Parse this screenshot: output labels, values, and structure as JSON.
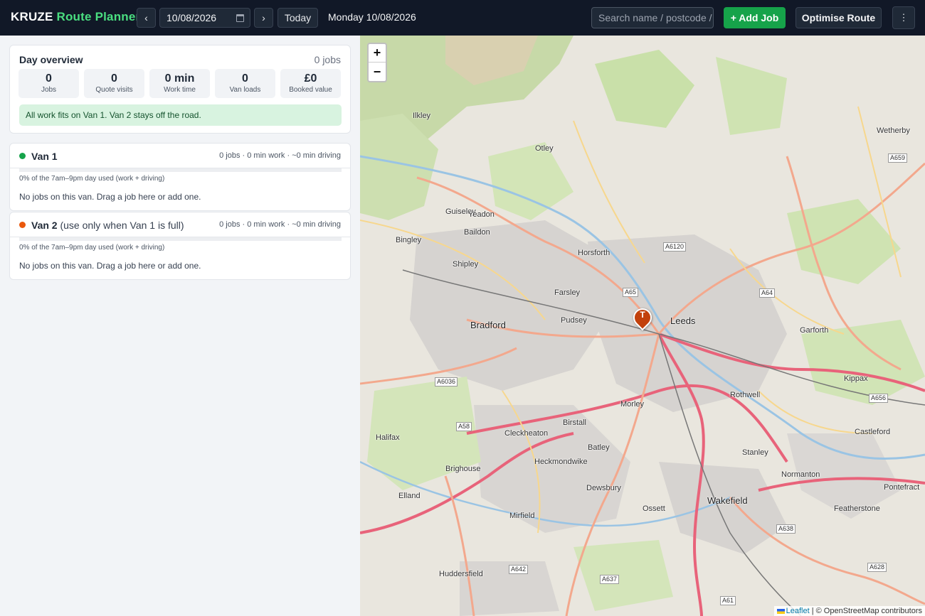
{
  "header": {
    "brand_part1": "KRUZE",
    "brand_part2": "Route Planner",
    "prev_label": "‹",
    "next_label": "›",
    "date_value": "10/08/2026",
    "today_label": "Today",
    "day_label": "Monday 10/08/2026",
    "search_placeholder": "Search name / postcode / ...",
    "add_job_label": "+ Add Job",
    "optimise_label": "Optimise Route",
    "more_label": "⋮"
  },
  "overview": {
    "title": "Day overview",
    "count": "0 jobs",
    "stats": [
      {
        "value": "0",
        "label": "Jobs"
      },
      {
        "value": "0",
        "label": "Quote visits"
      },
      {
        "value": "0 min",
        "label": "Work time"
      },
      {
        "value": "0",
        "label": "Van loads"
      },
      {
        "value": "£0",
        "label": "Booked value"
      }
    ],
    "note": "All work fits on Van 1. Van 2 stays off the road."
  },
  "vans": [
    {
      "name": "Van 1",
      "subtitle": "",
      "color": "#16a34a",
      "stats": "0 jobs · 0 min work · ~0 min driving",
      "usage_fraction": 0,
      "usage_text": "0% of the 7am–9pm day used (work + driving)",
      "empty_text": "No jobs on this van. Drag a job here or add one."
    },
    {
      "name": "Van 2",
      "subtitle": "(use only when Van 1 is full)",
      "color": "#ea580c",
      "stats": "0 jobs · 0 min work · ~0 min driving",
      "usage_fraction": 0,
      "usage_text": "0% of the 7am–9pm day used (work + driving)",
      "empty_text": "No jobs on this van. Drag a job here or add one."
    }
  ],
  "map": {
    "zoom_in": "+",
    "zoom_out": "−",
    "marker_letter": "T",
    "attribution_link": "Leaflet",
    "attribution_text": "| © OpenStreetMap contributors",
    "towns": [
      "Ilkley",
      "Otley",
      "Wetherby",
      "Guiseley",
      "Yeadon",
      "Baildon",
      "Bingley",
      "Horsforth",
      "Shipley",
      "Farsley",
      "Bradford",
      "Pudsey",
      "Leeds",
      "Garforth",
      "Kippax",
      "Rothwell",
      "Morley",
      "Birstall",
      "Cleckheaton",
      "Halifax",
      "Batley",
      "Castleford",
      "Stanley",
      "Heckmondwike",
      "Brighouse",
      "Dewsbury",
      "Normanton",
      "Pontefract",
      "Elland",
      "Ossett",
      "Wakefield",
      "Featherstone",
      "Mirfield",
      "Huddersfield"
    ],
    "roads": [
      "A659",
      "A6120",
      "A65",
      "A64",
      "A6036",
      "A58",
      "A656",
      "A638",
      "A642",
      "A637",
      "A628",
      "A61"
    ]
  }
}
